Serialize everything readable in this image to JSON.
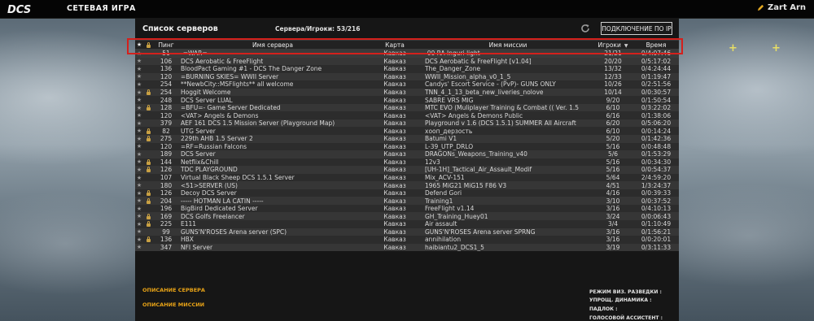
{
  "header": {
    "logo_text": "DCS",
    "title": "СЕТЕВАЯ ИГРА",
    "user_name": "Zart Arn"
  },
  "panel": {
    "title": "Список серверов",
    "server_player_count": "Сервера/Игроки: 53/216",
    "connect_ip_label": "ПОДКЛЮЧЕНИЕ ПО IP"
  },
  "columns": {
    "fav": "★",
    "ping": "Пинг",
    "name": "Имя сервера",
    "map": "Карта",
    "mission": "Имя миссии",
    "players": "Игроки",
    "time": "Время"
  },
  "servers": [
    {
      "lock": false,
      "ping": "51",
      "name": "-=WAR=-",
      "map": "Кавказ",
      "mission": "-00 RA Inguri light",
      "players": "21/21",
      "time": "0/4:07:46"
    },
    {
      "lock": false,
      "ping": "106",
      "name": "DCS Aerobatic & FreeFlight",
      "map": "Кавказ",
      "mission": "DCS Aerobatic & FreeFlight [v1.04]",
      "players": "20/20",
      "time": "0/5:17:02"
    },
    {
      "lock": false,
      "ping": "136",
      "name": "BloodPact Gaming #1 - DCS The Danger Zone",
      "map": "Кавказ",
      "mission": "The_Danger_Zone",
      "players": "13/32",
      "time": "0/4:24:44"
    },
    {
      "lock": false,
      "ping": "120",
      "name": "=BURNING SKIES= WWII Server",
      "map": "Кавказ",
      "mission": "WWII_Mission_alpha_v0_1_5",
      "players": "12/33",
      "time": "0/1:19:47"
    },
    {
      "lock": false,
      "ping": "254",
      "name": "**NewbCity::MSFlights** all welcome",
      "map": "Кавказ",
      "mission": "Candys' Escort Service  - (PvP)- GUNS ONLY",
      "players": "10/26",
      "time": "0/2:51:56"
    },
    {
      "lock": true,
      "ping": "254",
      "name": "Hoggit Welcome",
      "map": "Кавказ",
      "mission": "TNN_4_1_13_beta_new_liveries_nolove",
      "players": "10/14",
      "time": "0/0:30:57"
    },
    {
      "lock": false,
      "ping": "248",
      "name": "DCS Server LUAL",
      "map": "Кавказ",
      "mission": "SABRE VRS MIG",
      "players": "9/20",
      "time": "0/1:50:54"
    },
    {
      "lock": true,
      "ping": "128",
      "name": "=BFU=- Game Server Dedicated",
      "map": "Кавказ",
      "mission": "MTC EVO (Muliplayer Training & Combat (( Ver. 1.5",
      "players": "6/10",
      "time": "0/3:22:02"
    },
    {
      "lock": false,
      "ping": "120",
      "name": "<VAT> Angels & Demons",
      "map": "Кавказ",
      "mission": "<VAT> Angels & Demons Public",
      "players": "6/16",
      "time": "0/1:38:06"
    },
    {
      "lock": false,
      "ping": "379",
      "name": "AEF 161 DCS 1.5 Mission Server (Playground Map)",
      "map": "Кавказ",
      "mission": "Playground v 1.6 (DCS 1.5.1)  SUMMER All Aircraft",
      "players": "6/20",
      "time": "0/5:06:20"
    },
    {
      "lock": true,
      "ping": "82",
      "name": "UTG Server",
      "map": "Кавказ",
      "mission": "хооп_дерзость",
      "players": "6/10",
      "time": "0/0:14:24"
    },
    {
      "lock": true,
      "ping": "275",
      "name": "229th AHB 1.5 Server 2",
      "map": "Кавказ",
      "mission": "Batumi V1",
      "players": "5/20",
      "time": "0/1:42:36"
    },
    {
      "lock": false,
      "ping": "120",
      "name": "=RF=Russian Falcons",
      "map": "Кавказ",
      "mission": "L-39_UTP_DRLO",
      "players": "5/16",
      "time": "0/0:48:48"
    },
    {
      "lock": false,
      "ping": "189",
      "name": "DCS Server",
      "map": "Кавказ",
      "mission": "DRAGONs_Weapons_Training_v40",
      "players": "5/6",
      "time": "0/1:53:29"
    },
    {
      "lock": true,
      "ping": "144",
      "name": "Netflix&Chill",
      "map": "Кавказ",
      "mission": "12v3",
      "players": "5/16",
      "time": "0/0:34:30"
    },
    {
      "lock": true,
      "ping": "126",
      "name": "TDC PLAYGROUND",
      "map": "Кавказ",
      "mission": "[UH-1H]_Tactical_Air_Assault_Modif",
      "players": "5/16",
      "time": "0/0:54:37"
    },
    {
      "lock": false,
      "ping": "107",
      "name": "Virtual Black Sheep DCS 1.5.1 Server",
      "map": "Кавказ",
      "mission": "Mix_ACV-151",
      "players": "5/64",
      "time": "2/4:59:20"
    },
    {
      "lock": false,
      "ping": "180",
      "name": "<51>SERVER (US)",
      "map": "Кавказ",
      "mission": "1965 MiG21 MiG15 F86 V3",
      "players": "4/51",
      "time": "1/3:24:37"
    },
    {
      "lock": true,
      "ping": "126",
      "name": "Decoy DCS Server",
      "map": "Кавказ",
      "mission": "Defend Gori",
      "players": "4/16",
      "time": "0/0:39:33"
    },
    {
      "lock": true,
      "ping": "204",
      "name": "----- HOTMAN LA CATIN -----",
      "map": "Кавказ",
      "mission": "Training1",
      "players": "3/10",
      "time": "0/0:37:52"
    },
    {
      "lock": false,
      "ping": "196",
      "name": "BigBird Dedicated Server",
      "map": "Кавказ",
      "mission": "FreeFlight v1.14",
      "players": "3/16",
      "time": "0/4:10:13"
    },
    {
      "lock": true,
      "ping": "169",
      "name": "DCS Golfs Freelancer",
      "map": "Кавказ",
      "mission": "GH_Training_Huey01",
      "players": "3/24",
      "time": "0/0:06:43"
    },
    {
      "lock": true,
      "ping": "225",
      "name": "E111",
      "map": "Кавказ",
      "mission": "Air assault",
      "players": "3/4",
      "time": "0/1:10:49"
    },
    {
      "lock": false,
      "ping": "99",
      "name": "GUNS'N'ROSES Arena server (SPC)",
      "map": "Кавказ",
      "mission": "GUNS'N'ROSES Arena server SPRNG",
      "players": "3/16",
      "time": "0/1:56:21"
    },
    {
      "lock": true,
      "ping": "136",
      "name": "HBX",
      "map": "Кавказ",
      "mission": "annihilation",
      "players": "3/16",
      "time": "0/0:20:01"
    },
    {
      "lock": false,
      "ping": "347",
      "name": "NFI Server",
      "map": "Кавказ",
      "mission": "haibiantu2_DCS1_5",
      "players": "3/19",
      "time": "0/3:11:33"
    }
  ],
  "footer": {
    "server_desc_link": "ОПИСАНИЕ СЕРВЕРА",
    "mission_desc_link": "ОПИСАНИЕ МИССИИ",
    "labels": [
      "РЕЖИМ ВИЗ. РАЗВЕДКИ :",
      "УПРОЩ. ДИНАМИКА :",
      "ПАДЛОК :",
      "ГОЛОСОВОЙ АССИСТЕНТ :"
    ]
  },
  "colors": {
    "accent": "#e8a316",
    "highlight_border": "#d4201c",
    "lock_icon": "#c8a043"
  }
}
